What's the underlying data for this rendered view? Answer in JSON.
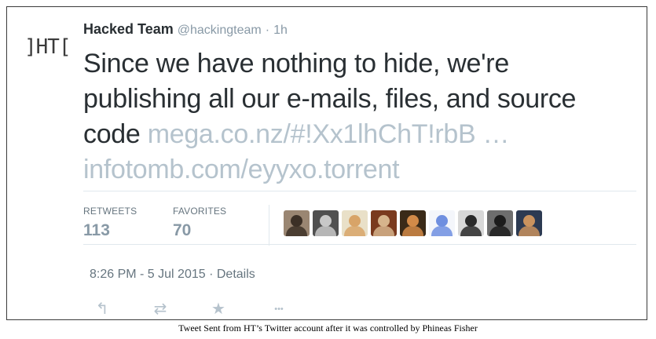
{
  "tweet": {
    "avatar_text": "]HT[",
    "author_name": "Hacked Team",
    "author_handle": "@hackingteam",
    "separator": "·",
    "age": "1h",
    "text_plain": "Since we have nothing to hide, we're publishing all our e-mails, files, and source code",
    "link_1": "mega.co.nz/#!Xx1lhChT!rbB …",
    "link_2": "infotomb.com/eyyxo.torrent",
    "retweets_label": "RETWEETS",
    "retweets_count": "113",
    "favorites_label": "FAVORITES",
    "favorites_count": "70",
    "timestamp": "8:26 PM - 5 Jul 2015",
    "details_sep": "·",
    "details_link": "Details",
    "favoriters": [
      {
        "name": "favoriter-avatar-1",
        "bg": "#9a8672",
        "fg": "#3c3026"
      },
      {
        "name": "favoriter-avatar-2",
        "bg": "#505050",
        "fg": "#c8c8c8"
      },
      {
        "name": "favoriter-avatar-3",
        "bg": "#e9e0c8",
        "fg": "#d8a468"
      },
      {
        "name": "favoriter-avatar-4",
        "bg": "#7a3a1e",
        "fg": "#d6b48c"
      },
      {
        "name": "favoriter-avatar-5",
        "bg": "#3a2a18",
        "fg": "#d28a48"
      },
      {
        "name": "favoriter-avatar-6",
        "bg": "#f4f6fb",
        "fg": "#6f8fe0"
      },
      {
        "name": "favoriter-avatar-7",
        "bg": "#d8d8d8",
        "fg": "#2a2a2a"
      },
      {
        "name": "favoriter-avatar-8",
        "bg": "#6e6e6e",
        "fg": "#1c1c1c"
      },
      {
        "name": "favoriter-avatar-9",
        "bg": "#2c3a52",
        "fg": "#c9925e"
      }
    ],
    "actions": [
      {
        "name": "reply-icon",
        "glyph": "↰"
      },
      {
        "name": "retweet-icon",
        "glyph": "⇄"
      },
      {
        "name": "favorite-icon",
        "glyph": "★"
      },
      {
        "name": "more-icon",
        "glyph": "•••"
      }
    ]
  },
  "caption": "Tweet Sent from HT’s Twitter account after it was controlled by Phineas Fisher",
  "colors": {
    "link": "#b5c3cd",
    "meta": "#8899a6",
    "text": "#292f33"
  }
}
